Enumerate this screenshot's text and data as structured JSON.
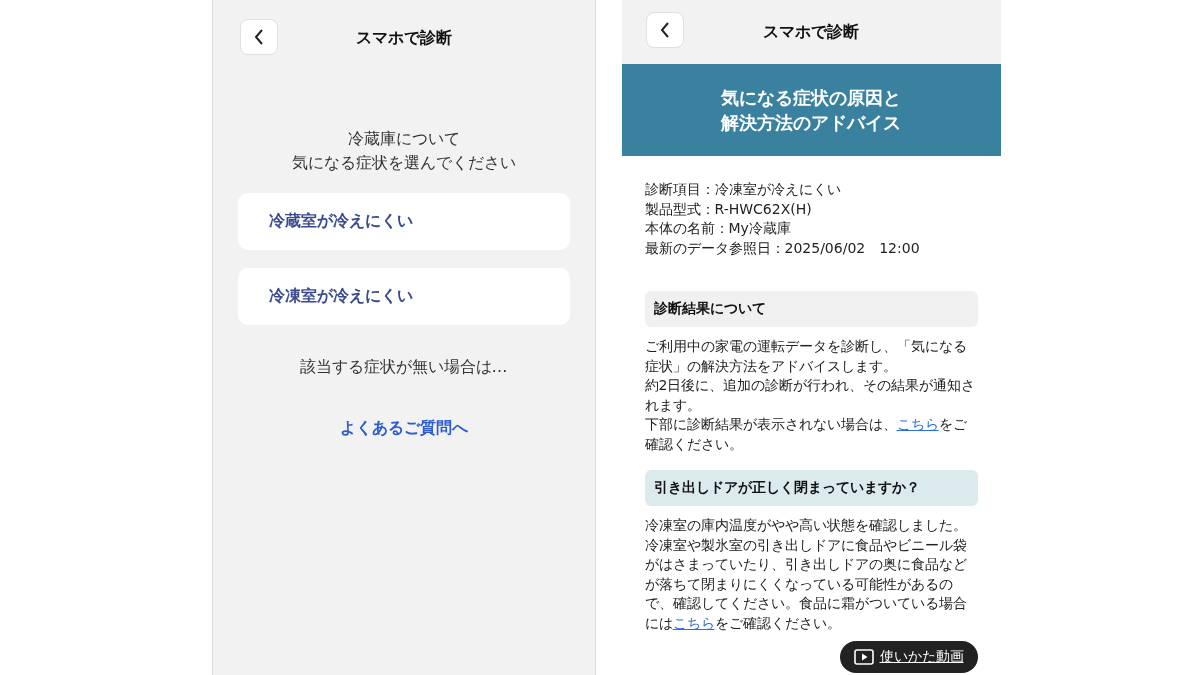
{
  "left_screen": {
    "header": {
      "title": "スマホで診断"
    },
    "prompt": [
      "冷蔵庫について",
      "気になる症状を選んでください"
    ],
    "options": [
      {
        "label": "冷蔵室が冷えにくい"
      },
      {
        "label": "冷凍室が冷えにくい"
      }
    ],
    "no_match_text": "該当する症状が無い場合は…",
    "faq_link": "よくあるご質問へ"
  },
  "right_screen": {
    "header": {
      "title": "スマホで診断"
    },
    "banner": [
      "気になる症状の原因と",
      "解決方法のアドバイス"
    ],
    "details": [
      "診断項目：冷凍室が冷えにくい",
      "製品型式：R-HWC62X(H)",
      "本体の名前：My冷蔵庫",
      "最新のデータ参照日：2025/06/02　12:00"
    ],
    "sections": [
      {
        "kind": "info",
        "heading": "診断結果について",
        "paragraphs": [
          [
            {
              "kind": "text",
              "text": "ご利用中の家電の運転データを診断し、「気になる症状」の解決方法をアドバイスします。"
            }
          ],
          [
            {
              "kind": "text",
              "text": "約2日後に、追加の診断が行われ、その結果が通知されます。"
            }
          ],
          [
            {
              "kind": "text",
              "text": "下部に診断結果が表示されない場合は、"
            },
            {
              "kind": "link",
              "text": "こちら"
            },
            {
              "kind": "text",
              "text": "をご確認ください。"
            }
          ]
        ]
      },
      {
        "kind": "advice",
        "heading": "引き出しドアが正しく閉まっていますか？",
        "paragraphs": [
          [
            {
              "kind": "text",
              "text": "冷凍室の庫内温度がやや高い状態を確認しました。冷凍室や製氷室の引き出しドアに食品やビニール袋がはさまっていたり、引き出しドアの奥に食品などが落ちて閉まりにくくなっている可能性があるので、確認してください。食品に霜がついている場合には"
            },
            {
              "kind": "link",
              "text": "こちら"
            },
            {
              "kind": "text",
              "text": "をご確認ください。"
            }
          ]
        ]
      }
    ],
    "video_button": "使いかた動画"
  }
}
